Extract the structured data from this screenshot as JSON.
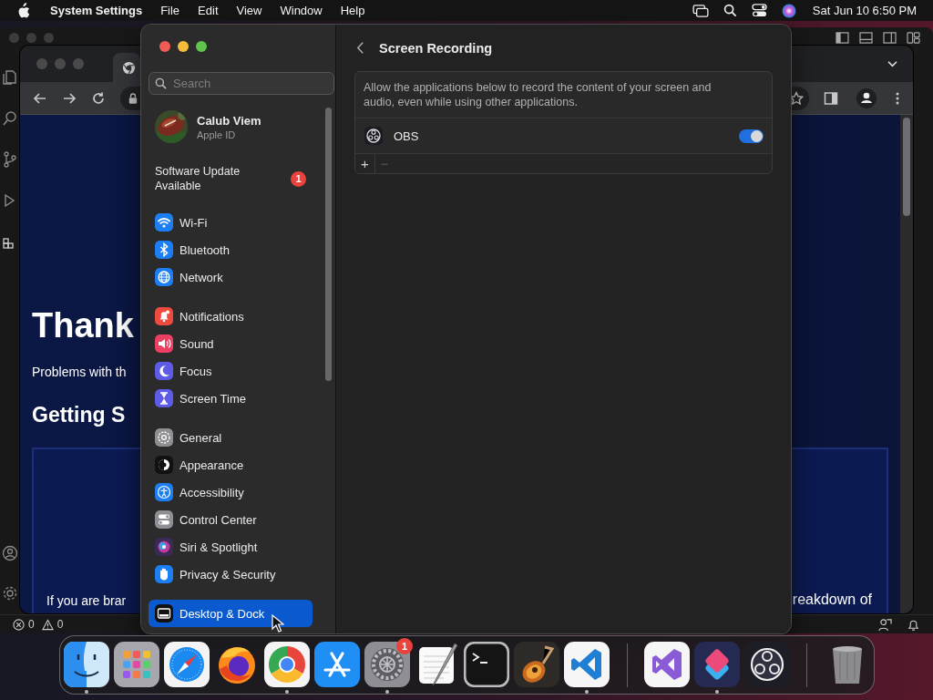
{
  "menu_bar": {
    "app_name": "System Settings",
    "menus": [
      "File",
      "Edit",
      "View",
      "Window",
      "Help"
    ],
    "clock": "Sat Jun 10 6:50 PM"
  },
  "editor_window": {
    "status_bar": {
      "errors": "0",
      "warnings": "0"
    }
  },
  "browser_window": {
    "page": {
      "heading": "Thank",
      "intro": "Problems with th",
      "subheading": "Getting S",
      "card_text_left": "If you are brar",
      "card_text_right": "reakdown of"
    }
  },
  "settings_window": {
    "search": {
      "placeholder": "Search"
    },
    "account": {
      "name": "Calub Viem",
      "subtitle": "Apple ID"
    },
    "software_update": {
      "label": "Software Update Available",
      "badge": "1"
    },
    "sidebar_groups": [
      {
        "items": [
          {
            "label": "Wi-Fi",
            "selected": false
          },
          {
            "label": "Bluetooth",
            "selected": false
          },
          {
            "label": "Network",
            "selected": false
          }
        ]
      },
      {
        "items": [
          {
            "label": "Notifications",
            "selected": false
          },
          {
            "label": "Sound",
            "selected": false
          },
          {
            "label": "Focus",
            "selected": false
          },
          {
            "label": "Screen Time",
            "selected": false
          }
        ]
      },
      {
        "items": [
          {
            "label": "General",
            "selected": false
          },
          {
            "label": "Appearance",
            "selected": false
          },
          {
            "label": "Accessibility",
            "selected": false
          },
          {
            "label": "Control Center",
            "selected": false
          },
          {
            "label": "Siri & Spotlight",
            "selected": false
          },
          {
            "label": "Privacy & Security",
            "selected": false
          }
        ]
      },
      {
        "items": [
          {
            "label": "Desktop & Dock",
            "selected": true
          }
        ]
      }
    ],
    "page": {
      "title": "Screen Recording",
      "description": "Allow the applications below to record the content of your screen and audio, even while using other applications.",
      "apps": [
        {
          "name": "OBS",
          "on": true
        }
      ],
      "add_button": {
        "label": "+",
        "disabled": false
      },
      "remove_button": {
        "label": "−",
        "disabled": true
      }
    }
  },
  "dock": {
    "apps": [
      {
        "running": true
      },
      {
        "running": false
      },
      {
        "running": false
      },
      {
        "running": false
      },
      {
        "running": true
      },
      {
        "running": false
      },
      {
        "running": true,
        "badge": "1"
      },
      {
        "running": false
      },
      {
        "running": false
      },
      {
        "running": false
      },
      {
        "running": true
      },
      {
        "running": false
      },
      {
        "running": true
      },
      {
        "running": false
      },
      {
        "running": false
      }
    ]
  }
}
